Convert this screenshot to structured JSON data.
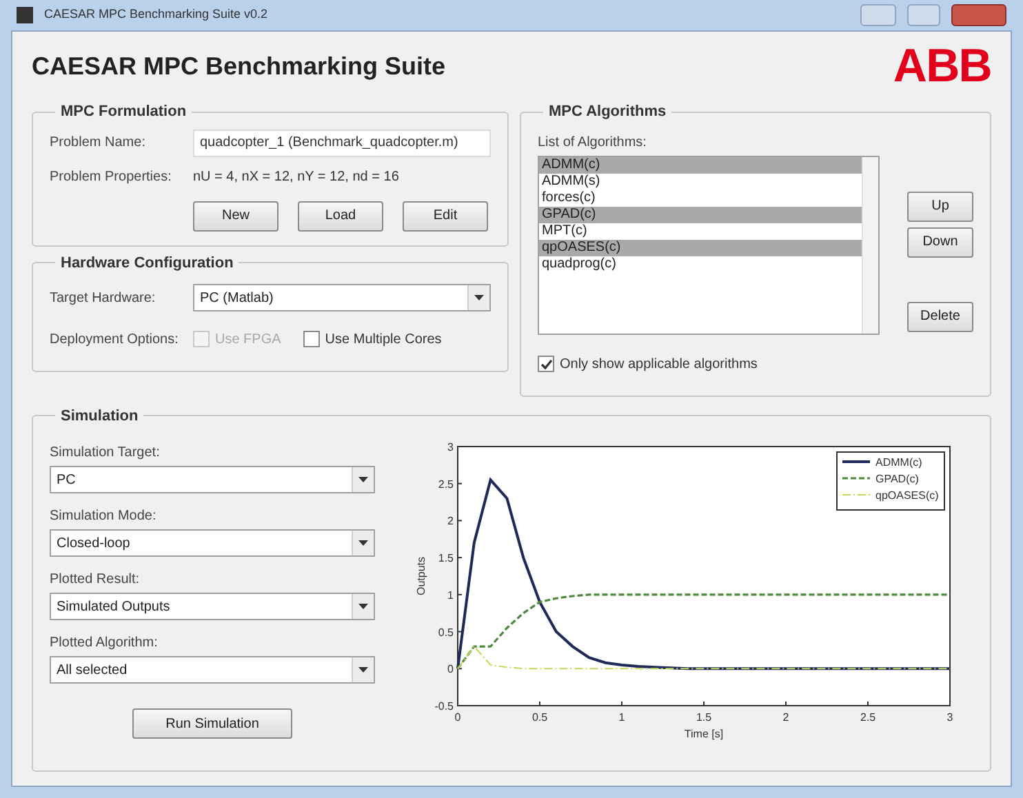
{
  "window": {
    "title": "CAESAR MPC Benchmarking Suite v0.2"
  },
  "header": {
    "title": "CAESAR MPC Benchmarking Suite",
    "logo": "ABB"
  },
  "mpc_formulation": {
    "title": "MPC Formulation",
    "problem_name_label": "Problem Name:",
    "problem_name": "quadcopter_1 (Benchmark_quadcopter.m)",
    "problem_properties_label": "Problem Properties:",
    "problem_properties": "nU = 4, nX = 12, nY = 12, nd = 16",
    "buttons": [
      "New",
      "Load",
      "Edit"
    ]
  },
  "hardware_configuration": {
    "title": "Hardware Configuration",
    "target_label": "Target Hardware:",
    "target": "PC (Matlab)",
    "deployment_label": "Deployment Options:",
    "options": [
      {
        "label": "Use FPGA",
        "checked": false,
        "disabled": true
      },
      {
        "label": "Use Multiple Cores",
        "checked": false,
        "disabled": false
      }
    ]
  },
  "mpc_algorithms": {
    "title": "MPC Algorithms",
    "list_label": "List of Algorithms:",
    "items": [
      {
        "label": "ADMM(c)",
        "selected": true
      },
      {
        "label": "ADMM(s)",
        "selected": false
      },
      {
        "label": "forces(c)",
        "selected": false
      },
      {
        "label": "GPAD(c)",
        "selected": true
      },
      {
        "label": "MPT(c)",
        "selected": false
      },
      {
        "label": "qpOASES(c)",
        "selected": true
      },
      {
        "label": "quadprog(c)",
        "selected": false
      }
    ],
    "buttons": [
      "Up",
      "Down",
      "Delete"
    ],
    "only_applicable": {
      "label": "Only show applicable algorithms",
      "checked": true
    }
  },
  "simulation": {
    "title": "Simulation",
    "fields": [
      {
        "label": "Simulation Target:",
        "value": "PC"
      },
      {
        "label": "Simulation Mode:",
        "value": "Closed-loop"
      },
      {
        "label": "Plotted Result:",
        "value": "Simulated Outputs"
      },
      {
        "label": "Plotted Algorithm:",
        "value": "All selected"
      }
    ],
    "run_button": "Run Simulation",
    "chart_data": {
      "type": "line",
      "xlabel": "Time [s]",
      "ylabel": "Outputs",
      "x": [
        0,
        0.1,
        0.2,
        0.3,
        0.4,
        0.5,
        0.6,
        0.7,
        0.8,
        0.9,
        1,
        1.1,
        1.2,
        1.3,
        1.4,
        1.5,
        1.6,
        1.7,
        1.8,
        1.9,
        2,
        2.1,
        2.2,
        2.3,
        2.4,
        2.5,
        2.6,
        2.7,
        2.8,
        2.9,
        3
      ],
      "series": [
        {
          "name": "ADMM(c)",
          "color": "#1f2a5a",
          "line_style": "solid",
          "values": [
            0,
            1.7,
            2.55,
            2.3,
            1.5,
            0.9,
            0.5,
            0.3,
            0.15,
            0.08,
            0.05,
            0.03,
            0.02,
            0.01,
            0,
            0,
            0,
            0,
            0,
            0,
            0,
            0,
            0,
            0,
            0,
            0,
            0,
            0,
            0,
            0,
            0
          ]
        },
        {
          "name": "GPAD(c)",
          "color": "#4a8a3a",
          "line_style": "dashed",
          "values": [
            0,
            0.3,
            0.3,
            0.55,
            0.75,
            0.9,
            0.95,
            0.98,
            1,
            1,
            1,
            1,
            1,
            1,
            1,
            1,
            1,
            1,
            1,
            1,
            1,
            1,
            1,
            1,
            1,
            1,
            1,
            1,
            1,
            1,
            1
          ]
        },
        {
          "name": "qpOASES(c)",
          "color": "#c8d85a",
          "line_style": "dashdot",
          "values": [
            0,
            0.3,
            0.05,
            0.02,
            0,
            0,
            0,
            0,
            0,
            0,
            0,
            0,
            0,
            0,
            0,
            0,
            0,
            0,
            0,
            0,
            0,
            0,
            0,
            0,
            0,
            0,
            0,
            0,
            0,
            0,
            0
          ]
        }
      ],
      "legend": "upper right",
      "xlim": [
        0,
        3
      ],
      "ylim": [
        -0.5,
        3
      ],
      "xticks": [
        0,
        0.5,
        1,
        1.5,
        2,
        2.5,
        3
      ],
      "yticks": [
        -0.5,
        0,
        0.5,
        1,
        1.5,
        2,
        2.5,
        3
      ]
    }
  }
}
